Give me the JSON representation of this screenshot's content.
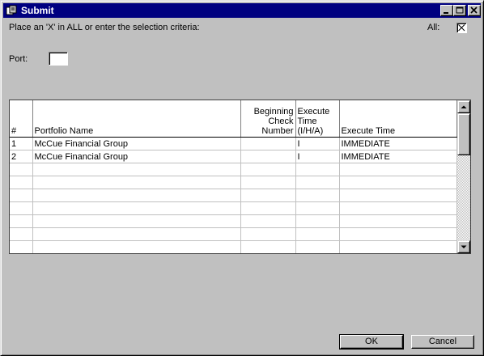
{
  "window": {
    "title": "Submit"
  },
  "criteria": {
    "instruction": "Place an 'X' in ALL or enter the selection criteria:",
    "all_label": "All:",
    "all_value": "X",
    "port_label": "Port:",
    "port_value": ""
  },
  "grid": {
    "columns": [
      "#",
      "Portfolio Name",
      "Beginning Check Number",
      "Execute Time (I/H/A)",
      "Execute Time"
    ],
    "rows": [
      [
        "1",
        "McCue Financial Group",
        "",
        "I",
        "IMMEDIATE"
      ],
      [
        "2",
        "McCue Financial Group",
        "",
        "I",
        "IMMEDIATE"
      ],
      [
        "",
        "",
        "",
        "",
        ""
      ],
      [
        "",
        "",
        "",
        "",
        ""
      ],
      [
        "",
        "",
        "",
        "",
        ""
      ],
      [
        "",
        "",
        "",
        "",
        ""
      ],
      [
        "",
        "",
        "",
        "",
        ""
      ],
      [
        "",
        "",
        "",
        "",
        ""
      ],
      [
        "",
        "",
        "",
        "",
        ""
      ]
    ]
  },
  "buttons": {
    "ok": "OK",
    "cancel": "Cancel"
  },
  "icons": {
    "app": "submit-app-icon",
    "minimize": "minimize-icon",
    "maximize": "maximize-icon",
    "close": "close-icon"
  }
}
